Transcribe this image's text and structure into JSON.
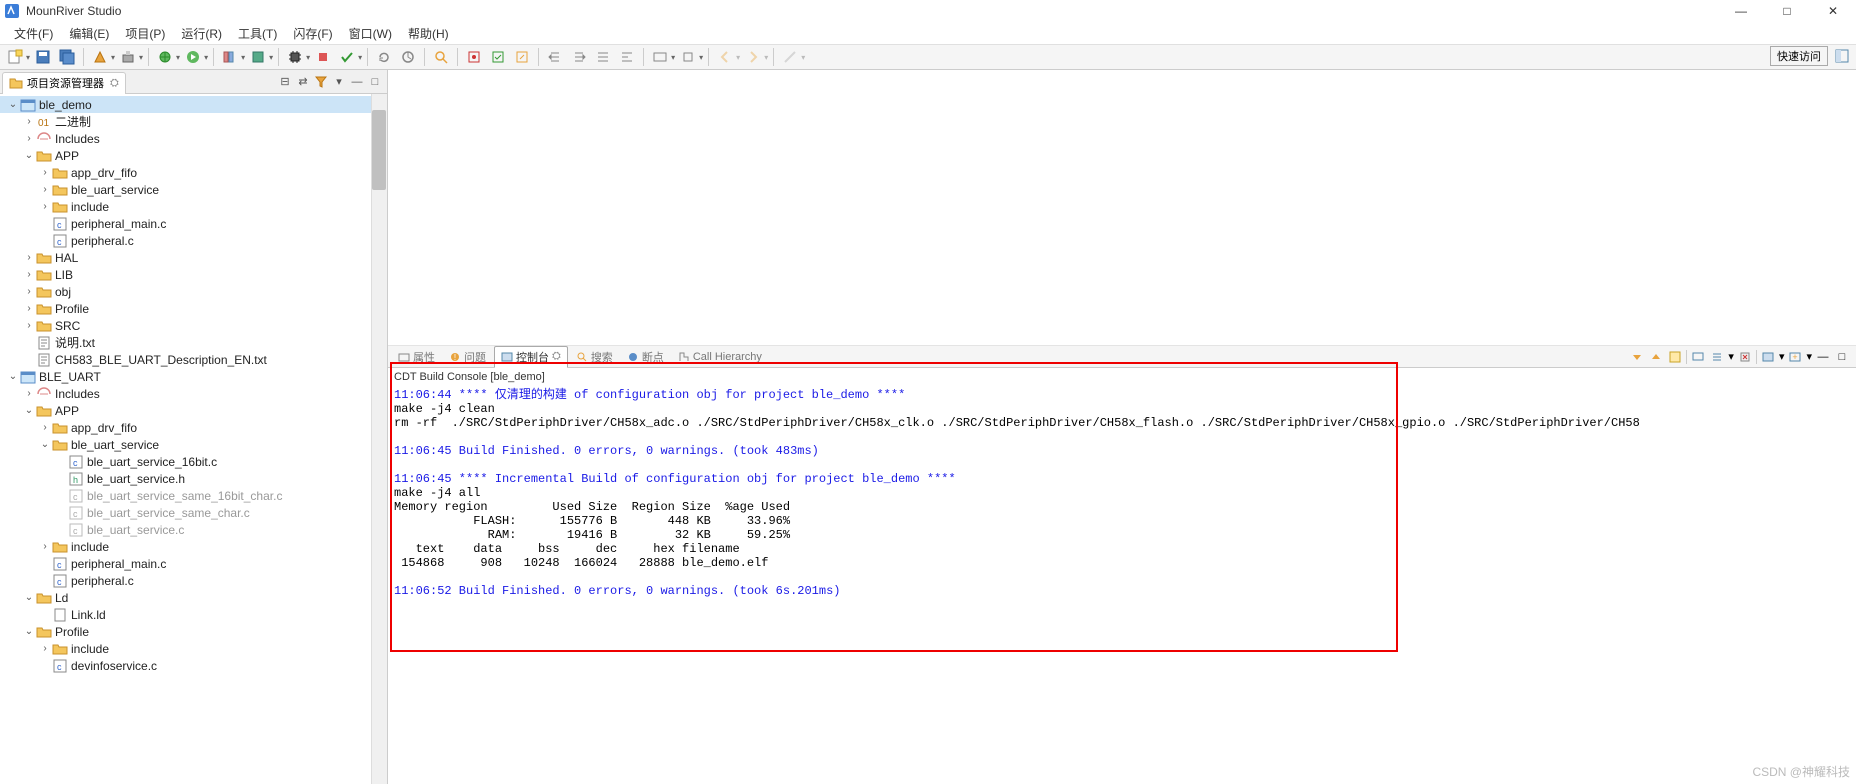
{
  "app": {
    "title": "MounRiver Studio"
  },
  "window_controls": {
    "min": "—",
    "max": "□",
    "close": "✕"
  },
  "menu": [
    "文件(F)",
    "编辑(E)",
    "项目(P)",
    "运行(R)",
    "工具(T)",
    "闪存(F)",
    "窗口(W)",
    "帮助(H)"
  ],
  "quick_access": "快速访问",
  "explorer": {
    "title": "项目资源管理器",
    "tree": [
      {
        "d": 0,
        "t": "o",
        "i": "pj",
        "l": "ble_demo",
        "sel": true
      },
      {
        "d": 1,
        "t": "c",
        "i": "bin",
        "l": "二进制"
      },
      {
        "d": 1,
        "t": "c",
        "i": "inc",
        "l": "Includes"
      },
      {
        "d": 1,
        "t": "o",
        "i": "fd",
        "l": "APP"
      },
      {
        "d": 2,
        "t": "c",
        "i": "fd",
        "l": "app_drv_fifo"
      },
      {
        "d": 2,
        "t": "c",
        "i": "fd",
        "l": "ble_uart_service"
      },
      {
        "d": 2,
        "t": "c",
        "i": "fd",
        "l": "include"
      },
      {
        "d": 2,
        "t": "",
        "i": "c",
        "l": "peripheral_main.c"
      },
      {
        "d": 2,
        "t": "",
        "i": "c",
        "l": "peripheral.c"
      },
      {
        "d": 1,
        "t": "c",
        "i": "fd",
        "l": "HAL"
      },
      {
        "d": 1,
        "t": "c",
        "i": "fd",
        "l": "LIB"
      },
      {
        "d": 1,
        "t": "c",
        "i": "fd",
        "l": "obj"
      },
      {
        "d": 1,
        "t": "c",
        "i": "fd",
        "l": "Profile"
      },
      {
        "d": 1,
        "t": "c",
        "i": "fd",
        "l": "SRC"
      },
      {
        "d": 1,
        "t": "",
        "i": "txt",
        "l": "说明.txt"
      },
      {
        "d": 1,
        "t": "",
        "i": "txt",
        "l": "CH583_BLE_UART_Description_EN.txt"
      },
      {
        "d": 0,
        "t": "o",
        "i": "pj",
        "l": "BLE_UART"
      },
      {
        "d": 1,
        "t": "c",
        "i": "inc",
        "l": "Includes"
      },
      {
        "d": 1,
        "t": "o",
        "i": "fd",
        "l": "APP"
      },
      {
        "d": 2,
        "t": "c",
        "i": "fd",
        "l": "app_drv_fifo"
      },
      {
        "d": 2,
        "t": "o",
        "i": "fd",
        "l": "ble_uart_service"
      },
      {
        "d": 3,
        "t": "",
        "i": "c",
        "l": "ble_uart_service_16bit.c"
      },
      {
        "d": 3,
        "t": "",
        "i": "h",
        "l": "ble_uart_service.h"
      },
      {
        "d": 3,
        "t": "",
        "i": "cg",
        "l": "ble_uart_service_same_16bit_char.c",
        "g": true
      },
      {
        "d": 3,
        "t": "",
        "i": "cg",
        "l": "ble_uart_service_same_char.c",
        "g": true
      },
      {
        "d": 3,
        "t": "",
        "i": "cg",
        "l": "ble_uart_service.c",
        "g": true
      },
      {
        "d": 2,
        "t": "c",
        "i": "fd",
        "l": "include"
      },
      {
        "d": 2,
        "t": "",
        "i": "c",
        "l": "peripheral_main.c"
      },
      {
        "d": 2,
        "t": "",
        "i": "c",
        "l": "peripheral.c"
      },
      {
        "d": 1,
        "t": "o",
        "i": "fd",
        "l": "Ld"
      },
      {
        "d": 2,
        "t": "",
        "i": "f",
        "l": "Link.ld"
      },
      {
        "d": 1,
        "t": "o",
        "i": "fd",
        "l": "Profile"
      },
      {
        "d": 2,
        "t": "c",
        "i": "fd",
        "l": "include"
      },
      {
        "d": 2,
        "t": "",
        "i": "c",
        "l": "devinfoservice.c"
      }
    ]
  },
  "bottom": {
    "tabs": [
      "属性",
      "问题",
      "控制台",
      "搜索",
      "断点",
      "Call Hierarchy"
    ],
    "active": 2,
    "console_title": "CDT Build Console [ble_demo]",
    "lines": [
      {
        "c": "blue",
        "t": "11:06:44 **** 仅清理的构建 of configuration obj for project ble_demo ****"
      },
      {
        "c": "black",
        "t": "make -j4 clean "
      },
      {
        "c": "black",
        "t": "rm -rf  ./SRC/StdPeriphDriver/CH58x_adc.o ./SRC/StdPeriphDriver/CH58x_clk.o ./SRC/StdPeriphDriver/CH58x_flash.o ./SRC/StdPeriphDriver/CH58x_gpio.o ./SRC/StdPeriphDriver/CH58"
      },
      {
        "c": "black",
        "t": ""
      },
      {
        "c": "blue",
        "t": "11:06:45 Build Finished. 0 errors, 0 warnings. (took 483ms)"
      },
      {
        "c": "black",
        "t": ""
      },
      {
        "c": "blue",
        "t": "11:06:45 **** Incremental Build of configuration obj for project ble_demo ****"
      },
      {
        "c": "black",
        "t": "make -j4 all "
      },
      {
        "c": "black",
        "t": "Memory region         Used Size  Region Size  %age Used"
      },
      {
        "c": "black",
        "t": "           FLASH:      155776 B       448 KB     33.96%"
      },
      {
        "c": "black",
        "t": "             RAM:       19416 B        32 KB     59.25%"
      },
      {
        "c": "black",
        "t": "   text\t   data\t    bss\t    dec\t    hex\tfilename"
      },
      {
        "c": "black",
        "t": " 154868\t    908\t  10248\t 166024\t  28888\tble_demo.elf"
      },
      {
        "c": "black",
        "t": ""
      },
      {
        "c": "blue",
        "t": "11:06:52 Build Finished. 0 errors, 0 warnings. (took 6s.201ms)"
      }
    ]
  },
  "watermark": "CSDN @神耀科技"
}
